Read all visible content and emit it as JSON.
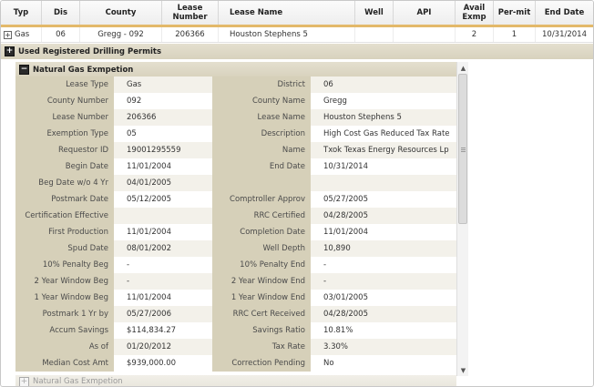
{
  "headers": {
    "typ": "Typ",
    "dis": "Dis",
    "county": "County",
    "lease_number": "Lease Number",
    "lease_name": "Lease Name",
    "well": "Well",
    "api": "API",
    "avail_exmp": "Avail Exmp",
    "permit": "Per-mit",
    "end_date": "End Date"
  },
  "row": {
    "expand_symbol": "+",
    "typ": "Gas",
    "dis": "06",
    "county": "Gregg - 092",
    "lease_number": "206366",
    "lease_name": "Houston Stephens 5",
    "well": "",
    "api": "",
    "avail_exmp": "2",
    "permit": "1",
    "end_date": "10/31/2014"
  },
  "sections": {
    "used_permits": {
      "icon": "+",
      "title": "Used Registered Drilling Permits"
    },
    "natural_gas": {
      "icon": "−",
      "title": "Natural Gas Exmpetion"
    },
    "natural_gas_2": {
      "icon": "+",
      "title": "Natural Gas Exmpetion"
    }
  },
  "details": [
    {
      "l1": "Lease Type",
      "v1": "Gas",
      "l2": "District",
      "v2": "06"
    },
    {
      "l1": "County Number",
      "v1": "092",
      "l2": "County Name",
      "v2": "Gregg"
    },
    {
      "l1": "Lease Number",
      "v1": "206366",
      "l2": "Lease Name",
      "v2": "Houston Stephens 5"
    },
    {
      "l1": "Exemption Type",
      "v1": "05",
      "l2": "Description",
      "v2": "High Cost Gas Reduced Tax Rate"
    },
    {
      "l1": "Requestor ID",
      "v1": "19001295559",
      "l2": "Name",
      "v2": "Txok Texas Energy Resources Lp"
    },
    {
      "l1": "Begin Date",
      "v1": "11/01/2004",
      "l2": "End Date",
      "v2": "10/31/2014"
    },
    {
      "l1": "Beg Date w/o 4 Yr",
      "v1": "04/01/2005",
      "l2": "",
      "v2": ""
    },
    {
      "l1": "Postmark Date",
      "v1": "05/12/2005",
      "l2": "Comptroller Approv",
      "v2": "05/27/2005"
    },
    {
      "l1": "Certification Effective",
      "v1": "",
      "l2": "RRC Certified",
      "v2": "04/28/2005"
    },
    {
      "l1": "First Production",
      "v1": "11/01/2004",
      "l2": "Completion Date",
      "v2": "11/01/2004"
    },
    {
      "l1": "Spud Date",
      "v1": "08/01/2002",
      "l2": "Well Depth",
      "v2": "10,890"
    },
    {
      "l1": "10% Penalty Beg",
      "v1": "-",
      "l2": "10% Penalty End",
      "v2": "-"
    },
    {
      "l1": "2 Year Window Beg",
      "v1": "-",
      "l2": "2 Year Window End",
      "v2": "-"
    },
    {
      "l1": "1 Year Window Beg",
      "v1": "11/01/2004",
      "l2": "1 Year Window End",
      "v2": "03/01/2005"
    },
    {
      "l1": "Postmark 1 Yr by",
      "v1": "05/27/2006",
      "l2": "RRC Cert Received",
      "v2": "04/28/2005"
    },
    {
      "l1": "Accum Savings",
      "v1": "$114,834.27",
      "l2": "Savings Ratio",
      "v2": "10.81%"
    },
    {
      "l1": "As of",
      "v1": "01/20/2012",
      "l2": "Tax Rate",
      "v2": "3.30%"
    },
    {
      "l1": "Median Cost Amt",
      "v1": "$939,000.00",
      "l2": "Correction Pending",
      "v2": "No"
    }
  ],
  "scrollbar": {
    "up_arrow": "▲",
    "down_arrow": "▼"
  },
  "colors": {
    "header_accent": "#e3b96a",
    "label_bg": "#d6d0b9",
    "row_light": "#ffffff",
    "row_alt": "#f3f1ea"
  }
}
